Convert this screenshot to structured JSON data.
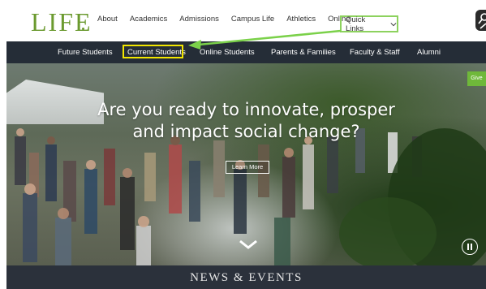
{
  "header": {
    "logo_text": "LIFE",
    "nav_items": [
      "About",
      "Academics",
      "Admissions",
      "Campus Life",
      "Athletics",
      "Online"
    ],
    "quick_links_label": "Quick Links",
    "search_icon": "search-icon"
  },
  "subnav": {
    "items": [
      "Future Students",
      "Current Students",
      "Online Students",
      "Parents & Families",
      "Faculty & Staff",
      "Alumni"
    ],
    "highlighted_item": "Current Students"
  },
  "hero": {
    "title_line1": "Are you ready to innovate, prosper",
    "title_line2": "and impact social change?",
    "cta_label": "Learn More",
    "give_label": "Give",
    "scroll_icon": "chevron-down-icon",
    "pause_icon": "pause-icon"
  },
  "news": {
    "title": "NEWS & EVENTS"
  },
  "colors": {
    "brand_green": "#6b9a2f",
    "nav_dark": "#252d37",
    "quick_links_border": "#8dd25e",
    "highlight_border": "#f2e600",
    "arrow_green": "#7bd14a",
    "give_green": "#6fb83a"
  }
}
